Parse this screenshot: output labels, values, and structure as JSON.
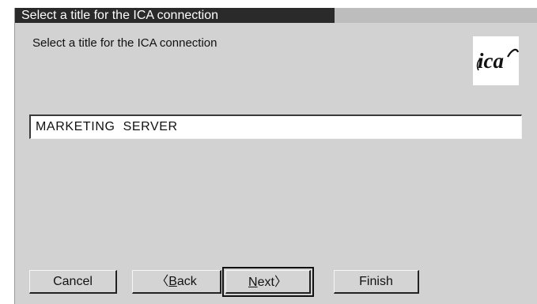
{
  "window": {
    "title": "Select a title for the ICA connection"
  },
  "content": {
    "prompt": "Select a title for the ICA connection",
    "logo_text": "ica",
    "logo_icon": "ica-logo-icon"
  },
  "connection_title_input": {
    "value": "MARKETING  SERVER"
  },
  "buttons": {
    "cancel": "Cancel",
    "back_arrow": "〈",
    "back_mnemonic": "B",
    "back_rest": "ack",
    "next_mnemonic": "N",
    "next_rest": "ext",
    "next_arrow": "〉",
    "finish": "Finish"
  }
}
